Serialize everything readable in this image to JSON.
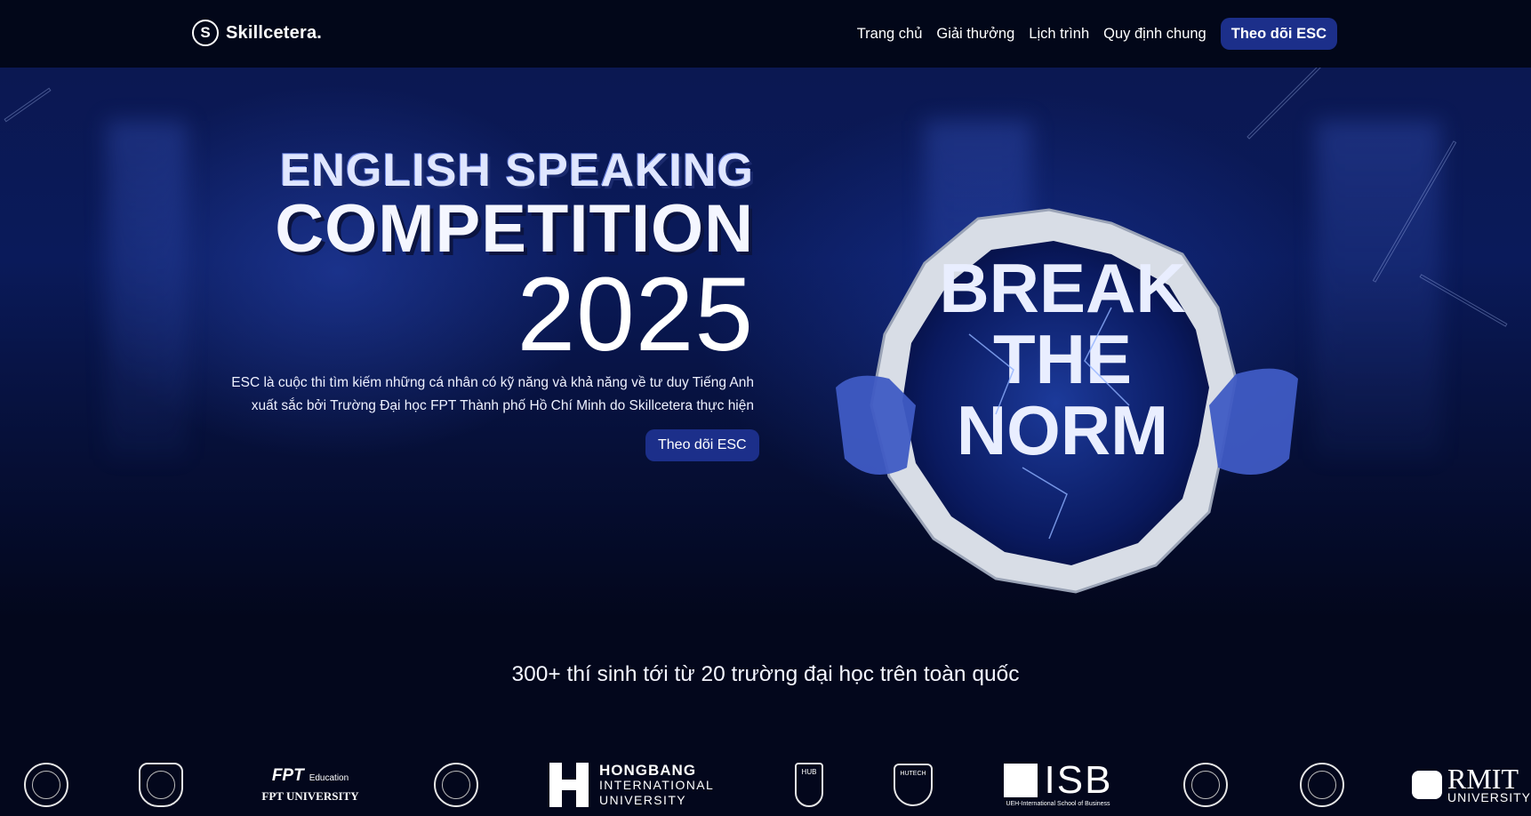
{
  "header": {
    "logo_icon": "skillcetera-s-logo-icon",
    "brand": "Skillcetera.",
    "nav": [
      "Trang chủ",
      "Giải thưởng",
      "Lịch trình",
      "Quy định chung"
    ],
    "cta": "Theo dõi ESC"
  },
  "hero": {
    "title_line1": "ENGLISH SPEAKING",
    "title_line2": "COMPETITION",
    "year": "2025",
    "description_line1": "ESC là cuộc thi tìm kiếm những cá nhân có kỹ năng và khả năng về tư duy Tiếng Anh",
    "description_line2": "xuất sắc bởi Trường Đại học FPT Thành phố Hồ Chí Minh do Skillcetera thực hiện",
    "cta": "Theo dõi ESC",
    "artwork": {
      "line1": "BREAK",
      "line2": "THE",
      "line3": "NORM"
    }
  },
  "stats": {
    "text": "300+ thí sinh tới từ 20 trường đại học trên toàn quốc"
  },
  "partners": {
    "fpt_brand": "FPT",
    "fpt_edu": "Education",
    "fpt_univ": "FPT UNIVERSITY",
    "hongbang_title": "HONGBANG",
    "hongbang_sub1": "INTERNATIONAL",
    "hongbang_sub2": "UNIVERSITY",
    "hub_label": "HUB",
    "hutech_label": "HUTECH",
    "isb_title": "ISB",
    "isb_sub": "UEH-International School of Business",
    "rmit_title": "RMIT",
    "rmit_sub": "UNIVERSITY"
  },
  "colors": {
    "accent": "#1c2f8a",
    "background": "#03071c"
  }
}
